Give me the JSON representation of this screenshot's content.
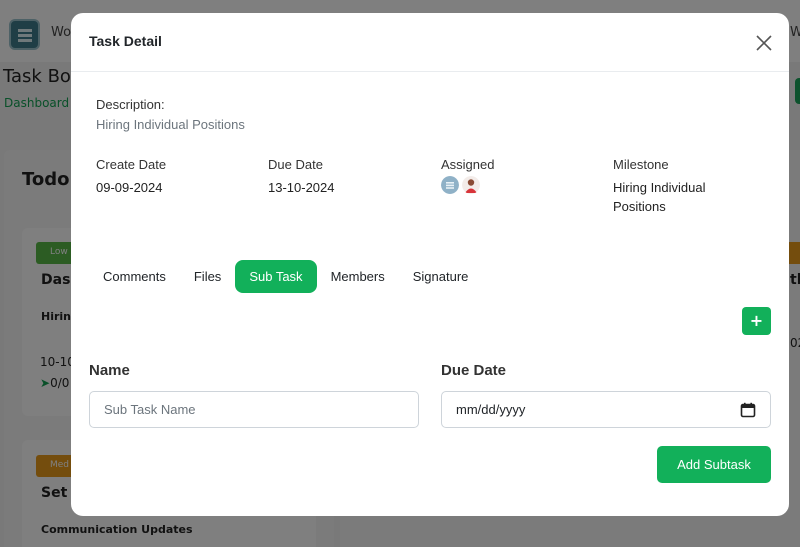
{
  "background": {
    "brand_prefix": "Wo",
    "brand_suffix": "W",
    "page_title": "Task Bo",
    "breadcrumb": "Dashboard",
    "column_title": "Todo",
    "cards": [
      {
        "badge": "Low",
        "title": "Dash",
        "subtitle": "Hiring",
        "date": "10-10",
        "count": "0/0",
        "badge_color": "#58b846"
      },
      {
        "badge": "Med",
        "title": "Set u",
        "subtitle": "Communication Updates",
        "badge_color": "#e89a1a"
      }
    ],
    "right_card_fragments": [
      "th",
      "02"
    ]
  },
  "modal": {
    "title": "Task Detail",
    "description_label": "Description:",
    "description_value": "Hiring Individual Positions",
    "create_date_label": "Create Date",
    "create_date_value": "09-09-2024",
    "due_date_label": "Due Date",
    "due_date_value": "13-10-2024",
    "assigned_label": "Assigned",
    "milestone_label": "Milestone",
    "milestone_value_line1": "Hiring Individual",
    "milestone_value_line2": "Positions",
    "tabs": [
      {
        "label": "Comments",
        "active": false
      },
      {
        "label": "Files",
        "active": false
      },
      {
        "label": "Sub Task",
        "active": true
      },
      {
        "label": "Members",
        "active": false
      },
      {
        "label": "Signature",
        "active": false
      }
    ],
    "add_icon": "+",
    "subtask_form": {
      "name_label": "Name",
      "name_placeholder": "Sub Task Name",
      "due_label": "Due Date",
      "due_placeholder": "mm/dd/yyyy",
      "submit_label": "Add Subtask"
    }
  },
  "colors": {
    "accent": "#12b05a",
    "overlay": "rgba(0,0,0,0.5)"
  }
}
